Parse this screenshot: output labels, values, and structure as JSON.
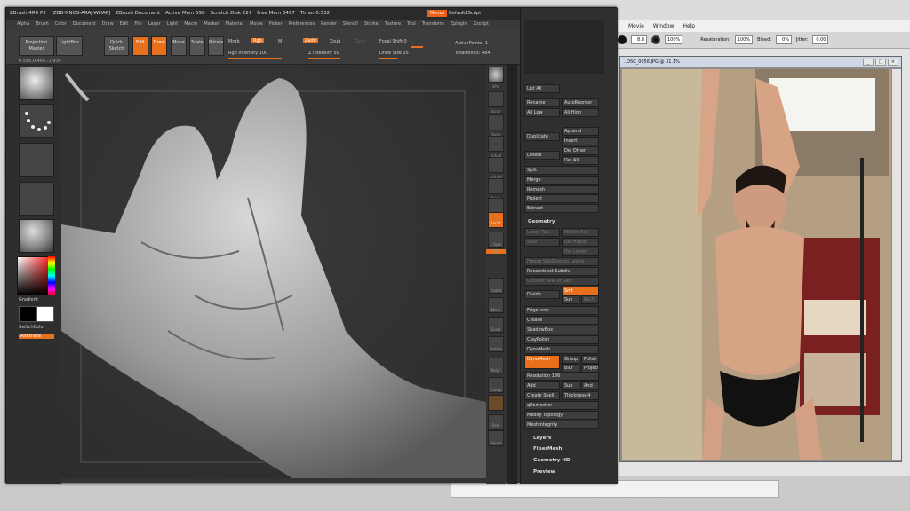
{
  "zb_title": {
    "app": "ZBrush 4R4 P2",
    "file": "[ZBB-NNOS-ARAJ-WHAP]",
    "doc": "ZBrush Document",
    "active": "Active Mem 598",
    "scratch": "Scratch Disk 227",
    "free": "Free Mem 3497",
    "timer": "Timer 0.532",
    "menus": "Menus",
    "script": "DefaultZScript"
  },
  "zb_menu": [
    "Alpha",
    "Brush",
    "Color",
    "Document",
    "Draw",
    "Edit",
    "File",
    "Layer",
    "Light",
    "Macro",
    "Marker",
    "Material",
    "Movie",
    "Picker",
    "Preferences",
    "Render",
    "Stencil",
    "Stroke",
    "Texture",
    "Tool",
    "Transform",
    "Zplugin",
    "Zscript"
  ],
  "shelf": {
    "projection": "Projection Master",
    "lightbox": "LightBox",
    "quick": "Quick Sketch",
    "edit": "Edit",
    "draw": "Draw",
    "move": "Move",
    "scale": "Scale",
    "rotate": "Rotate",
    "mrgb": "Mrgb",
    "rgb": "Rgb",
    "m": "M",
    "zadd": "Zadd",
    "zsub": "Zsub",
    "zcut": "Zcut",
    "rgb_int": "Rgb Intensity 100",
    "z_int": "Z Intensity 50",
    "focal": "Focal Shift 0",
    "draw_size": "Draw Size 35",
    "active_pts": "ActivePoints: 1",
    "total_pts": "TotalPoints: 484,",
    "coords": "0.586,0.465,-1.934"
  },
  "tray": {
    "gradient": "Gradient",
    "switch": "SwitchColor",
    "alternate": "Alternate"
  },
  "rtool": [
    "SPix",
    "Scroll",
    "Zoom",
    "Actual",
    "AAHalf",
    "Persp",
    "Floor",
    "Local",
    "L.Sym",
    "XYZ",
    "Frame",
    "Move",
    "Scale",
    "Rotate",
    "PolyF",
    "Transp",
    "Solo",
    "Xpose"
  ],
  "palette": {
    "listall": "List All",
    "rename": "Rename",
    "autoreorder": "AutoReorder",
    "alllow": "All Low",
    "allhigh": "All High",
    "duplicate": "Duplicate",
    "append": "Append",
    "insert": "Insert",
    "delete": "Delete",
    "delother": "Del Other",
    "delall": "Del All",
    "split": "Split",
    "merge": "Merge",
    "remesh": "Remesh",
    "project": "Project",
    "extract": "Extract",
    "geometry": "Geometry",
    "lowerres": "Lower Res",
    "higherres": "Higher Res",
    "sdiv": "SDiv",
    "delhigher": "Del Higher",
    "dellower": "Del Lower",
    "freeze": "Freeze SubDivision Levels",
    "reconstruct": "Reconstruct Subdiv",
    "convert": "Convert BPR To Geo",
    "divide": "Divide",
    "smt": "Smt",
    "suv": "Suv",
    "reuv": "ReUV",
    "edgeloop": "EdgeLoop",
    "crease": "Crease",
    "shadowbox": "ShadowBox",
    "claypolish": "ClayPolish",
    "dynamesh": "DynaMesh",
    "dynamesh_btn": "DynaMesh",
    "group": "Group",
    "polish": "Polish",
    "blur": "Blur",
    "project2": "Project",
    "resolution": "Resolution 136",
    "add": "Add",
    "sub": "Sub",
    "and": "And",
    "createshell": "Create Shell",
    "thickness": "Thickness 4",
    "qremesher": "qRemesher",
    "modtopo": "Modify Topology",
    "meshint": "MeshIntegrity",
    "layers": "Layers",
    "fibermesh": "FiberMesh",
    "geomhd": "Geometry HD",
    "preview": "Preview"
  },
  "ps": {
    "menu": [
      "Movie",
      "Window",
      "Help"
    ],
    "size": "8.8",
    "pct": "100%",
    "resat": "Resaturation:",
    "resat_v": "100%",
    "bleed": "Bleed:",
    "bleed_v": "0%",
    "jitter": "Jitter:",
    "jitter_v": "0.00",
    "doc": "..DSC_0056.JPG @ 31.1%"
  }
}
